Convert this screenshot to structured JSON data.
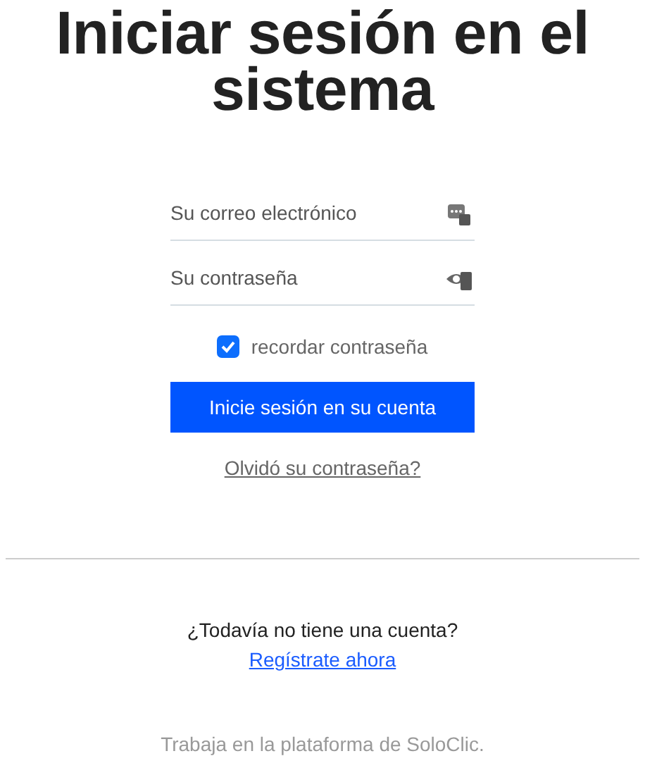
{
  "title": "Iniciar sesión en el sistema",
  "fields": [
    {
      "placeholder": "Su correo electrónico",
      "kind": "email"
    },
    {
      "placeholder": "Su contraseña",
      "kind": "password"
    }
  ],
  "remember": {
    "label": "recordar contraseña",
    "checked": true
  },
  "submit": "Inicie sesión en su cuenta",
  "forgot": "Olvidó su contraseña?",
  "signup": {
    "question": "¿Todavía no tiene una cuenta?",
    "link": "Regístrate ahora"
  },
  "footer": "Trabaja en la plataforma de SoloClic."
}
